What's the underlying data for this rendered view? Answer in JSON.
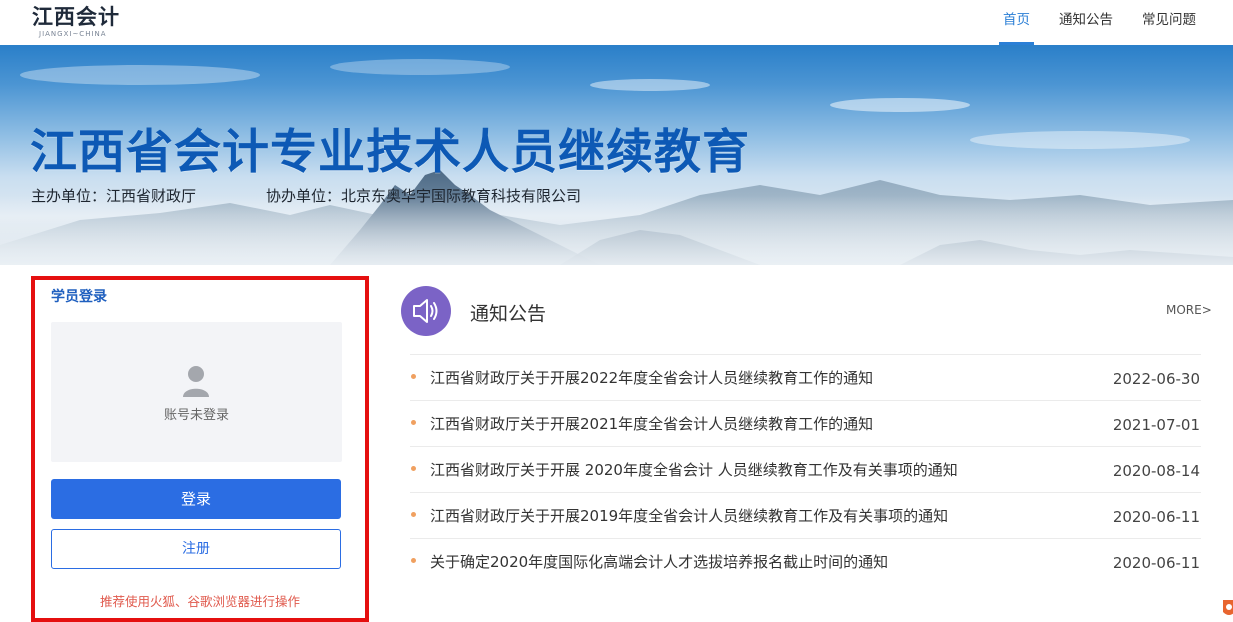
{
  "header": {
    "logo_main": "江西会计",
    "logo_sub": "JIANGXI~CHINA",
    "nav": [
      {
        "label": "首页",
        "active": true
      },
      {
        "label": "通知公告",
        "active": false
      },
      {
        "label": "常见问题",
        "active": false
      }
    ]
  },
  "banner": {
    "title": "江西省会计专业技术人员继续教育",
    "sponsor": "主办单位：江西省财政厅",
    "co_organizer": "协办单位：北京东奥华宇国际教育科技有限公司"
  },
  "login": {
    "title": "学员登录",
    "status": "账号未登录",
    "login_button": "登录",
    "register_button": "注册",
    "browser_tip": "推荐使用火狐、谷歌浏览器进行操作",
    "panel_border_color": "#e50f0f"
  },
  "notices": {
    "title": "通知公告",
    "more": "MORE>",
    "icon": "speaker-icon",
    "items": [
      {
        "title": "江西省财政厅关于开展2022年度全省会计人员继续教育工作的通知",
        "date": "2022-06-30"
      },
      {
        "title": "江西省财政厅关于开展2021年度全省会计人员继续教育工作的通知",
        "date": "2021-07-01"
      },
      {
        "title": "江西省财政厅关于开展 2020年度全省会计 人员继续教育工作及有关事项的通知",
        "date": "2020-08-14"
      },
      {
        "title": "江西省财政厅关于开展2019年度全省会计人员继续教育工作及有关事项的通知",
        "date": "2020-06-11"
      },
      {
        "title": "关于确定2020年度国际化高端会计人才选拔培养报名截止时间的通知",
        "date": "2020-06-11"
      }
    ]
  },
  "colors": {
    "accent": "#2b7fd6",
    "primary_button": "#2b6de3",
    "banner_title": "#0d59b5",
    "notice_icon_bg": "#7b63c6",
    "tip_text": "#e05a4d"
  }
}
